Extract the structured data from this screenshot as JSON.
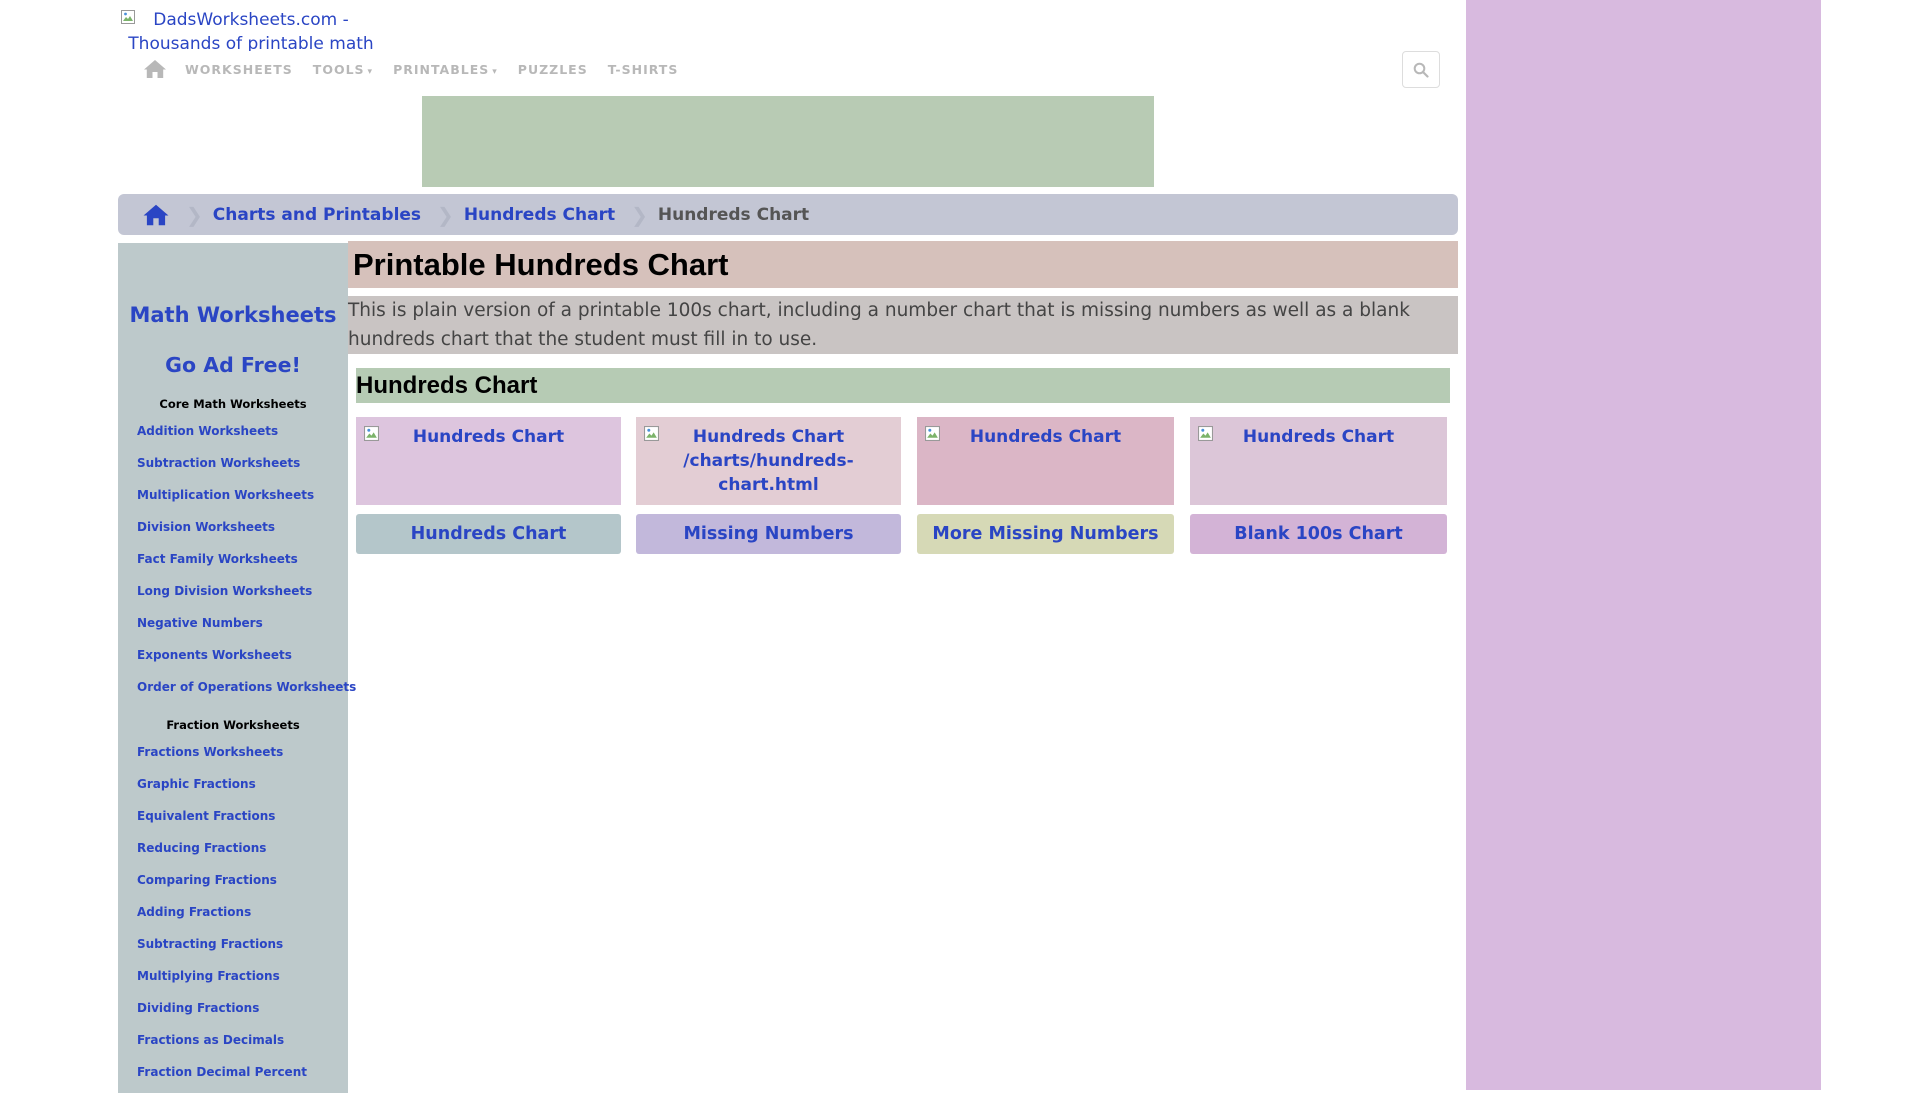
{
  "header": {
    "logo_alt": "DadsWorksheets.com - Thousands of printable math",
    "nav": [
      {
        "label": "WORKSHEETS",
        "dropdown": false
      },
      {
        "label": "TOOLS",
        "dropdown": true
      },
      {
        "label": "PRINTABLES",
        "dropdown": true
      },
      {
        "label": "PUZZLES",
        "dropdown": false
      },
      {
        "label": "T-SHIRTS",
        "dropdown": false
      }
    ],
    "dropdown_caret": "▾",
    "icons": {
      "home": "home-icon",
      "search": "search-icon",
      "broken_image": "broken-image-icon"
    }
  },
  "breadcrumb": {
    "separator": "❯",
    "items": [
      "Charts and Printables",
      "Hundreds Chart"
    ],
    "current": "Hundreds Chart"
  },
  "sidebar": {
    "title": "Math Worksheets",
    "ad_free": "Go Ad Free!",
    "sections": [
      {
        "heading": "Core Math Worksheets",
        "links": [
          "Addition Worksheets",
          "Subtraction Worksheets",
          "Multiplication Worksheets",
          "Division Worksheets",
          "Fact Family Worksheets",
          "Long Division Worksheets",
          "Negative Numbers",
          "Exponents Worksheets",
          "Order of Operations Worksheets"
        ]
      },
      {
        "heading": "Fraction Worksheets",
        "links": [
          "Fractions Worksheets",
          "Graphic Fractions",
          "Equivalent Fractions",
          "Reducing Fractions",
          "Comparing Fractions",
          "Adding Fractions",
          "Subtracting Fractions",
          "Multiplying Fractions",
          "Dividing Fractions",
          "Fractions as Decimals",
          "Fraction Decimal Percent"
        ]
      }
    ]
  },
  "main": {
    "title": "Printable Hundreds Chart",
    "intro": "This is plain version of a printable 100s chart, including a number chart that is missing numbers as well as a blank hundreds chart that the student must fill in to use.",
    "section_title": "Hundreds Chart",
    "cards": [
      {
        "image_alt": "Hundreds Chart",
        "label": "Hundreds Chart"
      },
      {
        "image_alt": "Hundreds Chart /charts/hundreds-chart.html",
        "label": "Missing Numbers"
      },
      {
        "image_alt": "Hundreds Chart",
        "label": "More Missing Numbers"
      },
      {
        "image_alt": "Hundreds Chart",
        "label": "Blank 100s Chart"
      }
    ]
  },
  "colors": {
    "link": "#2a45c4",
    "right_ad": "#d8badf",
    "top_ad": "#b8cbb4",
    "breadcrumb_bg": "#c3c6d4",
    "sidebar_bg": "#bdc9cb",
    "title_bg": "#d6c1bb",
    "intro_bg": "#c9c4c3",
    "section_bg": "#b6cbb4",
    "card_image_bgs": [
      "#ddc5de",
      "#e3cdd4",
      "#dbb6c6",
      "#dcc6d8"
    ],
    "card_button_bgs": [
      "#b4c6ca",
      "#c2b8db",
      "#d6d9b6",
      "#d3b3d6"
    ]
  }
}
